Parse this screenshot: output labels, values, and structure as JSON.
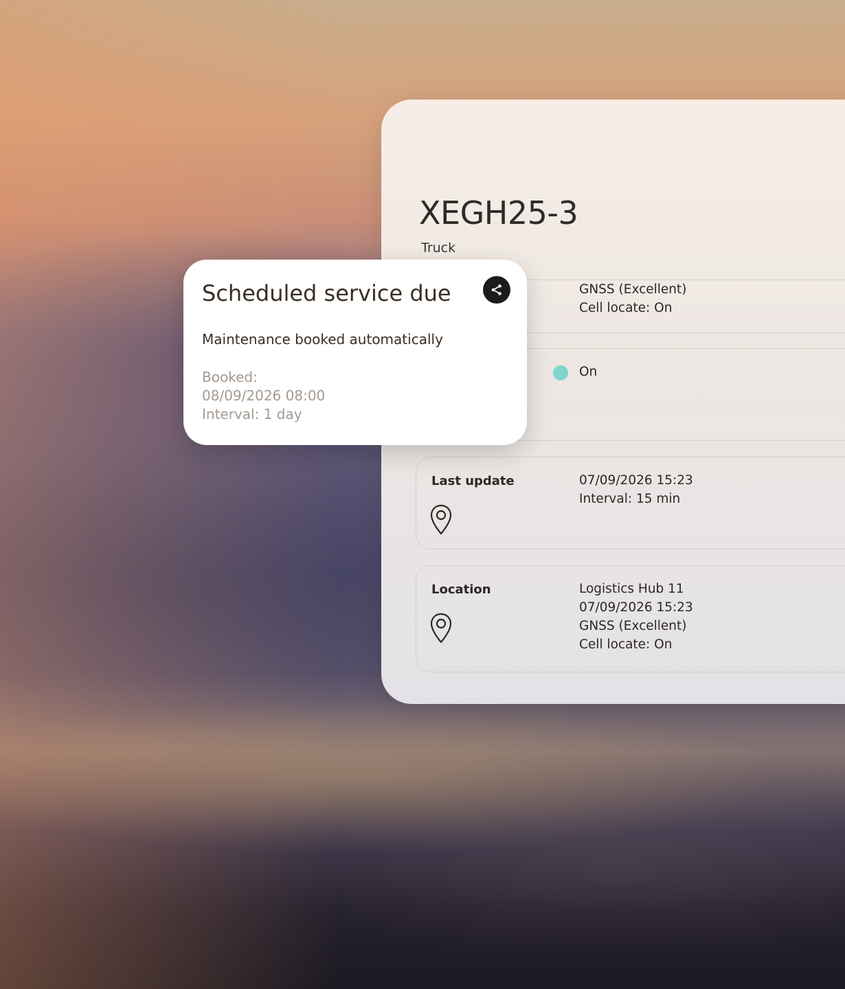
{
  "vehicle": {
    "id": "XEGH25-3",
    "type": "Truck"
  },
  "cards": {
    "gnss": {
      "line1": "GNSS (Excellent)",
      "line2": "Cell locate: On"
    },
    "power": {
      "status": "On",
      "status_color": "#7fd6cb"
    },
    "last_update": {
      "label": "Last update",
      "line1": "07/09/2026 15:23",
      "line2": "Interval: 15 min",
      "icon": "map-pin-icon"
    },
    "location": {
      "label": "Location",
      "line1": "Logistics Hub 11",
      "line2": "07/09/2026 15:23",
      "line3": "GNSS (Excellent)",
      "line4": "Cell locate: On",
      "icon": "map-pin-icon"
    }
  },
  "notification": {
    "title": "Scheduled service due",
    "subtitle": "Maintenance booked automatically",
    "booked_label": "Booked:",
    "booked_value": "08/09/2026 08:00",
    "interval": "Interval: 1 day",
    "share_icon": "share-icon"
  }
}
